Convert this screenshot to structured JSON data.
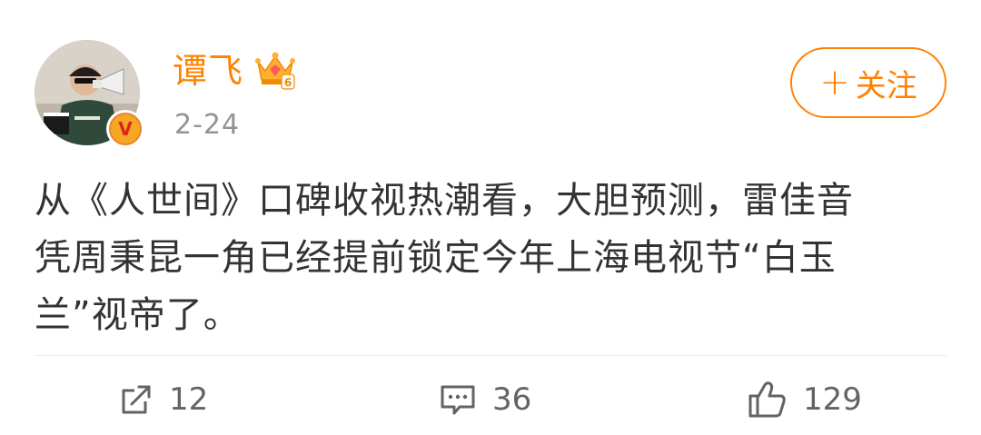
{
  "post": {
    "author": {
      "name": "谭飞",
      "avatar_icon": "avatar-photo-man-with-megaphone",
      "verified_badge": "V",
      "level_badge": "6"
    },
    "time": "2-24",
    "follow_label": "关注",
    "follow_plus": "+",
    "text_lines": [
      "从《人世间》口碑收视热潮看，大胆预测，雷佳音",
      "凭周秉昆一角已经提前锁定今年上海电视节“白玉",
      "兰”视帝了。"
    ]
  },
  "actions": {
    "share": {
      "icon": "share-icon",
      "count": "12"
    },
    "comment": {
      "icon": "comment-icon",
      "count": "36"
    },
    "like": {
      "icon": "like-icon",
      "count": "129"
    }
  },
  "colors": {
    "accent": "#ff8200",
    "text": "#333333",
    "meta": "#939393",
    "action": "#636363"
  }
}
